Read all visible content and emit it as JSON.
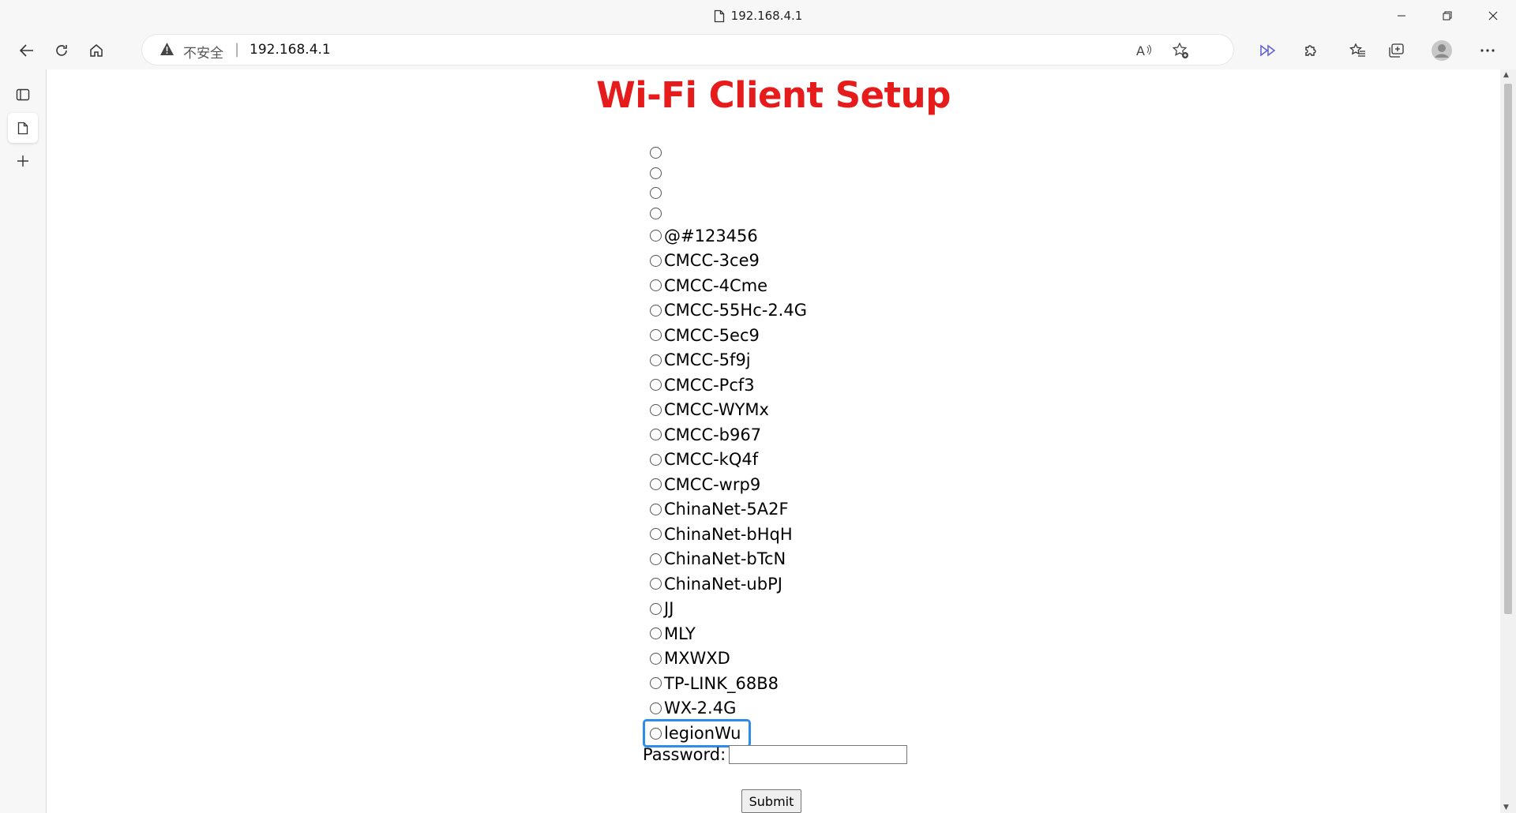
{
  "window": {
    "title": "192.168.4.1"
  },
  "address_bar": {
    "security_label": "不安全",
    "url": "192.168.4.1"
  },
  "page": {
    "title": "Wi-Fi Client Setup",
    "networks": [
      "",
      "",
      "",
      "",
      "@#123456",
      "CMCC-3ce9",
      "CMCC-4Cme",
      "CMCC-55Hc-2.4G",
      "CMCC-5ec9",
      "CMCC-5f9j",
      "CMCC-Pcf3",
      "CMCC-WYMx",
      "CMCC-b967",
      "CMCC-kQ4f",
      "CMCC-wrp9",
      "ChinaNet-5A2F",
      "ChinaNet-bHqH",
      "ChinaNet-bTcN",
      "ChinaNet-ubPJ",
      "JJ",
      "MLY",
      "MXWXD",
      "TP-LINK_68B8",
      "WX-2.4G",
      "legionWu"
    ],
    "password_label": "Password:",
    "password_value": "",
    "submit_label": "Submit"
  },
  "colors": {
    "title": "#e61b1b",
    "focus_ring": "#2d8de8"
  }
}
